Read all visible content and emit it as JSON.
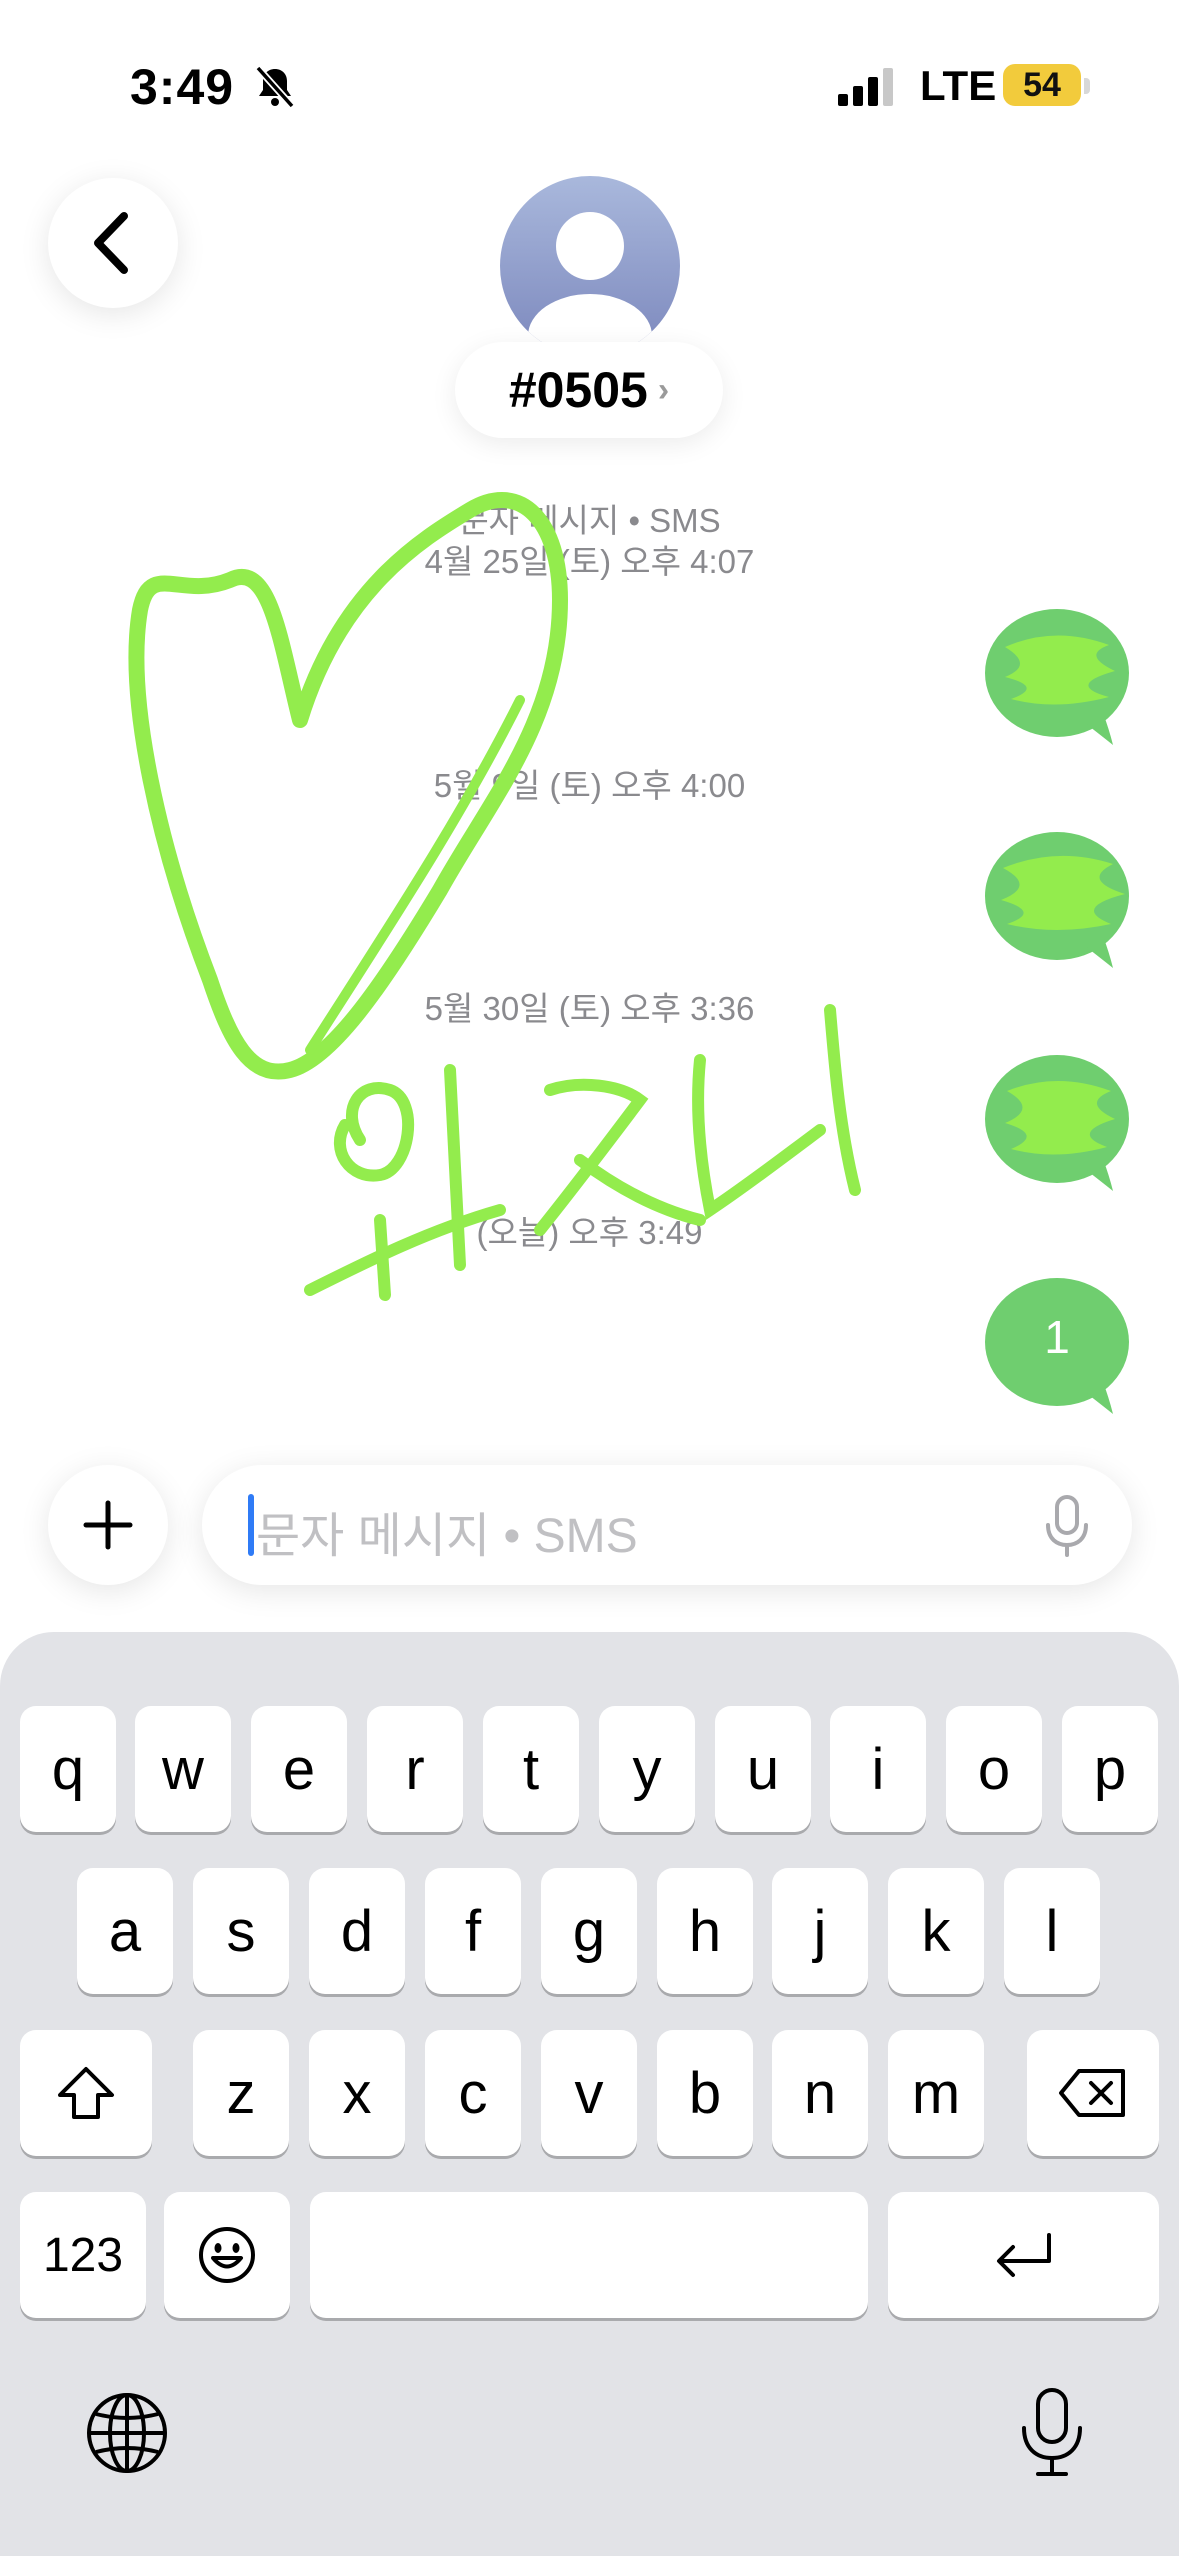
{
  "status_bar": {
    "time": "3:49",
    "network": "LTE",
    "battery": "54",
    "battery_color": "#f2cb3c",
    "icons": [
      "bell-slash-icon",
      "signal-icon",
      "battery-icon"
    ]
  },
  "header": {
    "contact_name": "#0505",
    "contact_chevron": "›",
    "icons": [
      "back-chevron-icon",
      "person-avatar-icon"
    ]
  },
  "conversation": {
    "service_label": "문자 메시지 • SMS",
    "timestamps": [
      "4월 25일 (토) 오후 4:07",
      "5월 9일 (토) 오후 4:00",
      "5월 30일 (토) 오후 3:36",
      "(오늘) 오후 3:49"
    ],
    "last_message": "1",
    "bubble_color": "#6fce6f",
    "scribble_color": "#93ec4d",
    "scribble_text": "위즈너"
  },
  "composer": {
    "placeholder": "문자 메시지 • SMS",
    "icons": [
      "plus-icon",
      "microphone-icon"
    ]
  },
  "keyboard": {
    "row1": [
      "q",
      "w",
      "e",
      "r",
      "t",
      "y",
      "u",
      "i",
      "o",
      "p"
    ],
    "row2": [
      "a",
      "s",
      "d",
      "f",
      "g",
      "h",
      "j",
      "k",
      "l"
    ],
    "row3": [
      "z",
      "x",
      "c",
      "v",
      "b",
      "n",
      "m"
    ],
    "numbers_key": "123",
    "icons": [
      "shift-icon",
      "delete-icon",
      "emoji-icon",
      "return-icon",
      "globe-icon",
      "dictation-icon"
    ]
  }
}
